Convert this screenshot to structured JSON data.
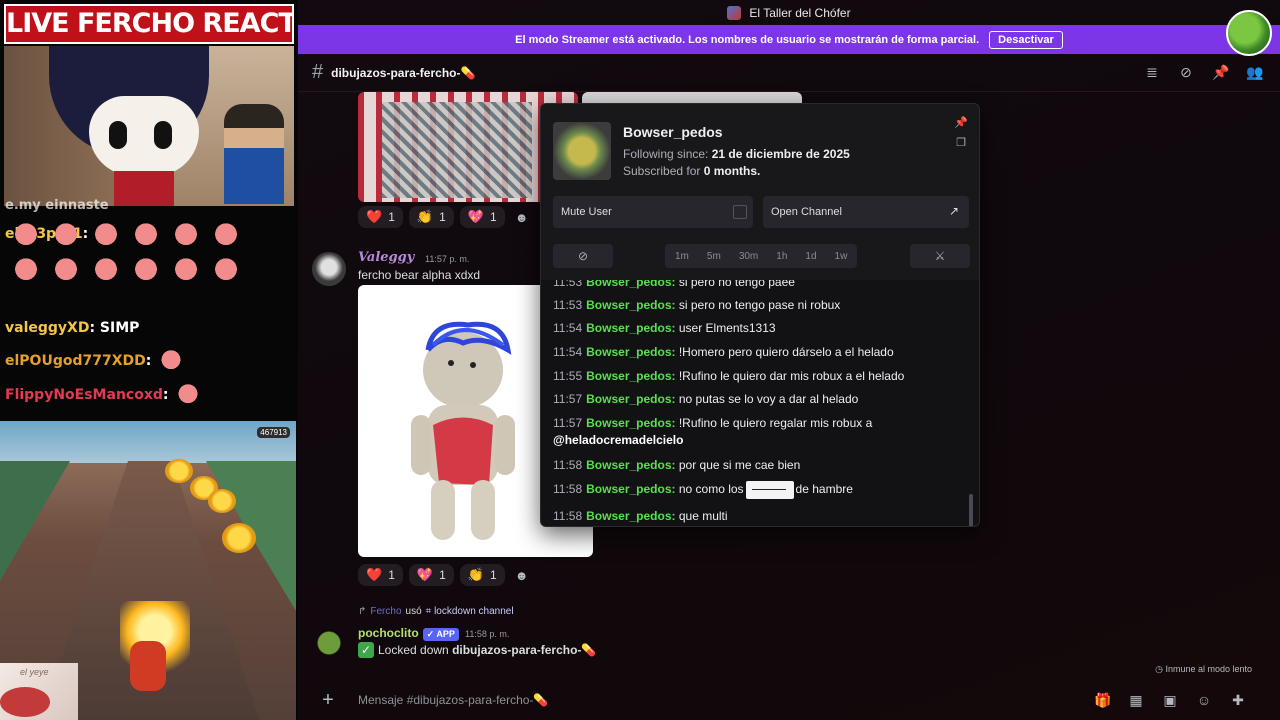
{
  "stream": {
    "title": "LIVE FERCHO REACTION",
    "cut_line": "e.my einnaste",
    "overlay_chat": [
      {
        "user": "el_p3p3_1",
        "sep": ":",
        "msg": ""
      },
      {
        "user": "valeggyXD",
        "sep": ":",
        "msg": " SIMP"
      },
      {
        "user": "elPOUgod777XDD",
        "sep": ":",
        "msg": ""
      },
      {
        "user": "FlippyNoEsMancoxd",
        "sep": ":",
        "msg": ""
      }
    ],
    "game_score": "467913",
    "thumb_label": "el yeye"
  },
  "titlebar": {
    "server_name": "El Taller del Chófer"
  },
  "streamer_bar": {
    "text": "El modo Streamer está activado. Los nombres de usuario se mostrarán de forma parcial.",
    "button": "Desactivar"
  },
  "channel": {
    "name": "dibujazos-para-fercho-💊"
  },
  "reactions_1": [
    {
      "emoji": "❤️",
      "count": "1"
    },
    {
      "emoji": "👏",
      "count": "1"
    },
    {
      "emoji": "💖",
      "count": "1"
    }
  ],
  "message_valeggy": {
    "author": "Valeggy",
    "time": "11:57 p. m.",
    "text": "fercho bear alpha xdxd"
  },
  "reactions_2": [
    {
      "emoji": "❤️",
      "count": "1"
    },
    {
      "emoji": "💖",
      "count": "1"
    },
    {
      "emoji": "👏",
      "count": "1"
    }
  ],
  "system_line": {
    "user": "Fercho",
    "action": "usó",
    "command": "lockdown channel"
  },
  "message_bot": {
    "author": "pochoclito",
    "badge": "APP",
    "time": "11:58 p. m.",
    "text_pre": "Locked down ",
    "text_channel": "dibujazos-para-fercho-💊"
  },
  "slowmode": "Inmune al modo lento",
  "composer": {
    "placeholder": "Mensaje #dibujazos-para-fercho-💊"
  },
  "popup": {
    "username": "Bowser_pedos",
    "following_label": "Following since:",
    "following_date": "21 de diciembre de 2025",
    "subscribed_label": "Subscribed for",
    "subscribed_value": "0 months.",
    "mute_label": "Mute User",
    "open_label": "Open Channel",
    "timeouts": [
      "1m",
      "5m",
      "30m",
      "1h",
      "1d",
      "1w"
    ],
    "chat": [
      {
        "time": "11:53",
        "user": "Bowser_pedos",
        "msg": "si pero no tengo paee"
      },
      {
        "time": "11:53",
        "user": "Bowser_pedos",
        "msg": "si pero no tengo pase ni robux"
      },
      {
        "time": "11:54",
        "user": "Bowser_pedos",
        "msg": "user Elments1313"
      },
      {
        "time": "11:54",
        "user": "Bowser_pedos",
        "msg": "!Homero pero quiero dárselo a el helado"
      },
      {
        "time": "11:55",
        "user": "Bowser_pedos",
        "msg": "!Rufino le quiero dar mis robux a el helado"
      },
      {
        "time": "11:57",
        "user": "Bowser_pedos",
        "msg": "no putas se lo voy a dar al helado"
      },
      {
        "time": "11:57",
        "user": "Bowser_pedos",
        "msg": "!Rufino le quiero regalar mis robux a",
        "mention": "@heladocremadelcielo"
      },
      {
        "time": "11:58",
        "user": "Bowser_pedos",
        "msg": "por que si me cae bien"
      },
      {
        "time": "11:58",
        "user": "Bowser_pedos",
        "msg": "no como los",
        "msg2": "de hambre"
      },
      {
        "time": "11:58",
        "user": "Bowser_pedos",
        "msg": "que multi"
      }
    ]
  }
}
